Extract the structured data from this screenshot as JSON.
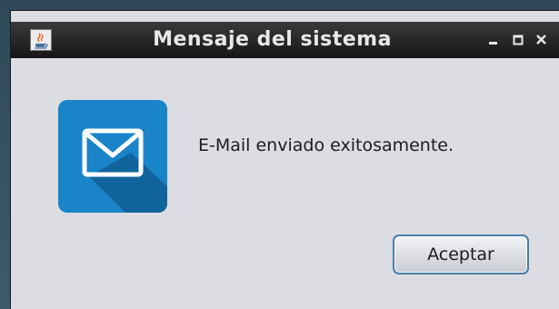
{
  "window": {
    "title": "Mensaje del sistema",
    "app_icon": "java-coffee-icon",
    "controls": {
      "minimize_icon": "minimize-icon",
      "maximize_icon": "maximize-icon",
      "close_icon": "close-icon"
    }
  },
  "dialog": {
    "icon": "mail-envelope-icon",
    "message": "E-Mail enviado exitosamente.",
    "accept_label": "Aceptar"
  },
  "colors": {
    "titlebar": "#1e1e1e",
    "title_text": "#e8e8e8",
    "dialog_bg": "#dcdde3",
    "icon_bg": "#1a84c9",
    "button_border": "#4a7ca8"
  }
}
